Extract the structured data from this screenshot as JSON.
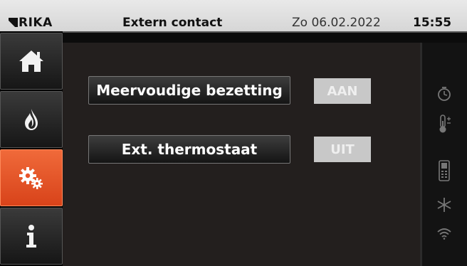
{
  "brand": {
    "logo_text": "RIKA"
  },
  "header": {
    "title": "Extern contact",
    "date": "Zo 06.02.2022",
    "time": "15:55"
  },
  "nav": {
    "items": [
      {
        "icon": "home-icon",
        "active": false
      },
      {
        "icon": "flame-icon",
        "active": false
      },
      {
        "icon": "gears-icon",
        "active": true
      },
      {
        "icon": "info-icon",
        "active": false
      }
    ]
  },
  "settings": [
    {
      "label": "Meervoudige bezetting",
      "state": "AAN"
    },
    {
      "label": "Ext. thermostaat",
      "state": "UIT"
    }
  ],
  "status_icons": [
    "clock-icon",
    "thermometer-icon",
    "remote-icon",
    "snowflake-icon",
    "wifi-icon"
  ],
  "colors": {
    "accent": "#e8532a",
    "content_bg": "#231f1e",
    "badge_bg": "#c8c8c8"
  }
}
